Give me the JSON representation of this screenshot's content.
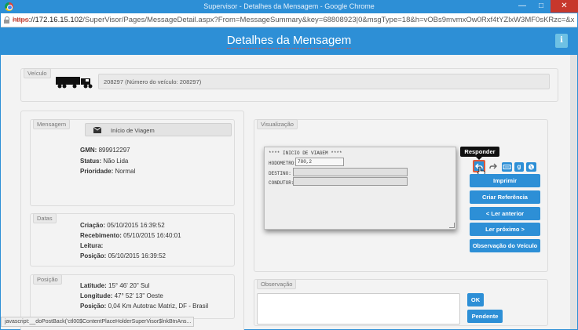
{
  "window": {
    "title": "Supervisor - Detalhes da Mensagem - Google Chrome",
    "min_glyph": "—",
    "max_glyph": "□",
    "close_glyph": "✕"
  },
  "address": {
    "scheme": "https",
    "host": "://172.16.15.102",
    "rest": "/SuperVisor/Pages/MessageDetail.aspx?From=MessageSummary&key=68808923|0&msgType=18&h=vOBs9mvmxOw0Rxf4tYZlxW3MF0sKRzc=&x"
  },
  "header": {
    "title": "Detalhes da Mensagem",
    "info_label": "i"
  },
  "veiculo": {
    "legend": "Veículo",
    "text": "208297 (Número do veículo: 208297)"
  },
  "mensagem": {
    "legend": "Mensagem",
    "type": "Início de Viagem",
    "gmn_label": "GMN:",
    "gmn_value": "899912297",
    "status_label": "Status:",
    "status_value": "Não Lida",
    "prioridade_label": "Prioridade:",
    "prioridade_value": "Normal"
  },
  "datas": {
    "legend": "Datas",
    "criacao_label": "Criação:",
    "criacao_value": "05/10/2015 16:39:52",
    "recebimento_label": "Recebimento:",
    "recebimento_value": "05/10/2015 16:40:01",
    "leitura_label": "Leitura:",
    "leitura_value": "",
    "posicao_label": "Posição:",
    "posicao_value": "05/10/2015 16:39:52"
  },
  "posicao": {
    "legend": "Posição",
    "latitude_label": "Latitude:",
    "latitude_value": "15° 46' 20\" Sul",
    "longitude_label": "Longitude:",
    "longitude_value": "47° 52' 13\" Oeste",
    "posicao_label": "Posição:",
    "posicao_value": "0,04 Km Autotrac Matriz, DF - Brasil"
  },
  "visualizacao": {
    "legend": "Visualização",
    "form_title": "**** INICIO DE VIAGEM ****",
    "hodometro_label": "HODOMETRO:",
    "hodometro_value": "780,2",
    "destino_label": "DESTINO:",
    "destino_value": "",
    "condutor_label": "CONDUTOR:",
    "condutor_value": ""
  },
  "tooltip": {
    "text": "Responder"
  },
  "actions": {
    "imprimir": "Imprimir",
    "criar_referencia": "Criar Referência",
    "ler_anterior": "< Ler anterior",
    "ler_proximo": "Ler próximo >",
    "observacao_veiculo": "Observação do Veículo"
  },
  "observacao": {
    "legend": "Observação",
    "value": "",
    "ok": "OK",
    "pendente": "Pendente"
  },
  "statusbar": {
    "text": "javascript:__doPostBack('ctl00$ContentPlaceHolderSuperVisor$lnkBtnAns..."
  },
  "colors": {
    "brand_blue": "#2d8fd6",
    "info_blue": "#6ec1e4",
    "close_red": "#c7372c"
  },
  "icons": {
    "reply": "reply-icon",
    "forward": "forward-icon",
    "keyboard": "keyboard-icon",
    "google": "google-icon",
    "globe": "globe-icon",
    "envelope": "envelope-icon",
    "truck": "truck-icon"
  }
}
